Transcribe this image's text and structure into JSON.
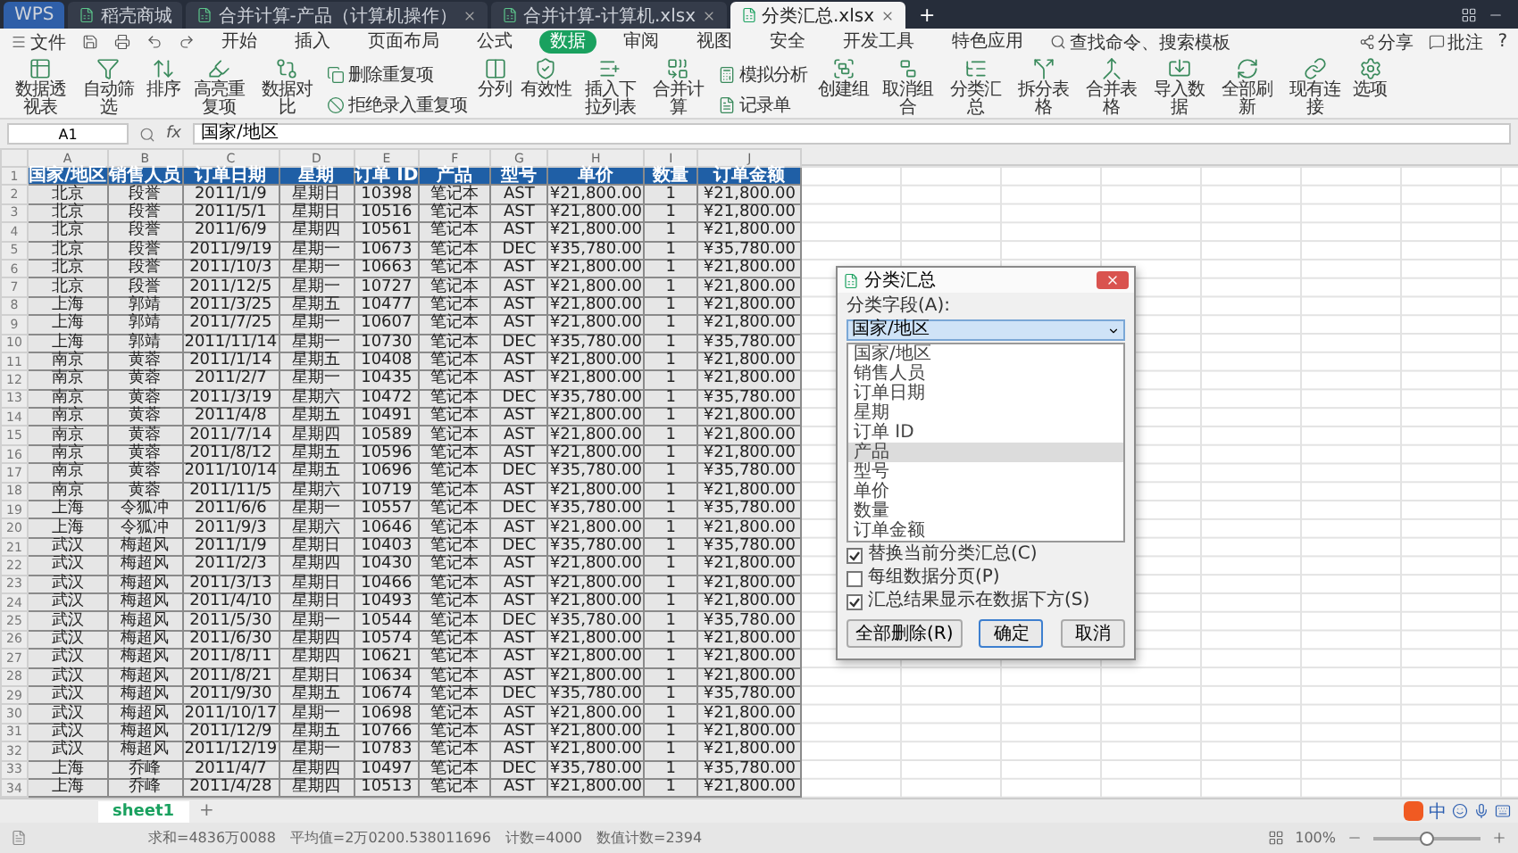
{
  "title_bar": {
    "tabs": [
      {
        "label": "WPS",
        "kind": "app",
        "selected": false
      },
      {
        "label": "稻壳商城",
        "kind": "doc",
        "selected": false
      },
      {
        "label": "合并计算-产品（计算机操作）",
        "kind": "doc",
        "selected": false
      },
      {
        "label": "合并计算-计算机.xlsx",
        "kind": "doc",
        "selected": false
      },
      {
        "label": "分类汇总.xlsx",
        "kind": "doc",
        "selected": true
      }
    ],
    "new_tab": "+"
  },
  "menu": {
    "file": "文件",
    "tabs": [
      {
        "label": "开始",
        "selected": false
      },
      {
        "label": "插入",
        "selected": false
      },
      {
        "label": "页面布局",
        "selected": false
      },
      {
        "label": "公式",
        "selected": false
      },
      {
        "label": "数据",
        "selected": true
      },
      {
        "label": "审阅",
        "selected": false
      },
      {
        "label": "视图",
        "selected": false
      },
      {
        "label": "安全",
        "selected": false
      },
      {
        "label": "开发工具",
        "selected": false
      },
      {
        "label": "特色应用",
        "selected": false
      }
    ],
    "search": "查找命令、搜索模板",
    "share": "分享",
    "comment": "批注",
    "help": "?"
  },
  "ribbon": [
    {
      "kind": "large",
      "label": "数据透视表"
    },
    {
      "kind": "large",
      "label": "自动筛选"
    },
    {
      "kind": "large",
      "label": "排序"
    },
    {
      "kind": "large",
      "label": "高亮重复项"
    },
    {
      "kind": "large",
      "label": "数据对比"
    },
    {
      "kind": "stack",
      "items": [
        "删除重复项",
        "拒绝录入重复项"
      ]
    },
    {
      "kind": "large",
      "label": "分列"
    },
    {
      "kind": "large",
      "label": "有效性"
    },
    {
      "kind": "large",
      "label": "插入下拉列表"
    },
    {
      "kind": "large",
      "label": "合并计算"
    },
    {
      "kind": "stack",
      "items": [
        "模拟分析",
        "记录单"
      ]
    },
    {
      "kind": "large",
      "label": "创建组"
    },
    {
      "kind": "large",
      "label": "取消组合"
    },
    {
      "kind": "large",
      "label": "分类汇总"
    },
    {
      "kind": "large",
      "label": "拆分表格"
    },
    {
      "kind": "large",
      "label": "合并表格"
    },
    {
      "kind": "large",
      "label": "导入数据"
    },
    {
      "kind": "large",
      "label": "全部刷新"
    },
    {
      "kind": "large",
      "label": "现有连接"
    },
    {
      "kind": "large",
      "label": "选项"
    }
  ],
  "formula_bar": {
    "name_box": "A1",
    "fx": "fx",
    "value": "国家/地区"
  },
  "sheet": {
    "columns": [
      "A",
      "B",
      "C",
      "D",
      "E",
      "F",
      "G",
      "H",
      "I",
      "J"
    ],
    "header": {
      "number": "1",
      "cells": [
        "国家/地区",
        "销售人员",
        "订单日期",
        "星期",
        "订单 ID",
        "产品",
        "型号",
        "单价",
        "数量",
        "订单金额"
      ]
    },
    "rows": [
      {
        "number": "2",
        "cells": [
          "北京",
          "段誉",
          "2011/1/9",
          "星期日",
          "10398",
          "笔记本",
          "AST",
          "¥21,800.00",
          "1",
          "¥21,800.00"
        ]
      },
      {
        "number": "3",
        "cells": [
          "北京",
          "段誉",
          "2011/5/1",
          "星期日",
          "10516",
          "笔记本",
          "AST",
          "¥21,800.00",
          "1",
          "¥21,800.00"
        ]
      },
      {
        "number": "4",
        "cells": [
          "北京",
          "段誉",
          "2011/6/9",
          "星期四",
          "10561",
          "笔记本",
          "AST",
          "¥21,800.00",
          "1",
          "¥21,800.00"
        ]
      },
      {
        "number": "5",
        "cells": [
          "北京",
          "段誉",
          "2011/9/19",
          "星期一",
          "10673",
          "笔记本",
          "DEC",
          "¥35,780.00",
          "1",
          "¥35,780.00"
        ]
      },
      {
        "number": "6",
        "cells": [
          "北京",
          "段誉",
          "2011/10/3",
          "星期一",
          "10663",
          "笔记本",
          "AST",
          "¥21,800.00",
          "1",
          "¥21,800.00"
        ]
      },
      {
        "number": "7",
        "cells": [
          "北京",
          "段誉",
          "2011/12/5",
          "星期一",
          "10727",
          "笔记本",
          "AST",
          "¥21,800.00",
          "1",
          "¥21,800.00"
        ]
      },
      {
        "number": "8",
        "cells": [
          "上海",
          "郭靖",
          "2011/3/25",
          "星期五",
          "10477",
          "笔记本",
          "AST",
          "¥21,800.00",
          "1",
          "¥21,800.00"
        ]
      },
      {
        "number": "9",
        "cells": [
          "上海",
          "郭靖",
          "2011/7/25",
          "星期一",
          "10607",
          "笔记本",
          "AST",
          "¥21,800.00",
          "1",
          "¥21,800.00"
        ]
      },
      {
        "number": "10",
        "cells": [
          "上海",
          "郭靖",
          "2011/11/14",
          "星期一",
          "10730",
          "笔记本",
          "DEC",
          "¥35,780.00",
          "1",
          "¥35,780.00"
        ]
      },
      {
        "number": "11",
        "cells": [
          "南京",
          "黄蓉",
          "2011/1/14",
          "星期五",
          "10408",
          "笔记本",
          "AST",
          "¥21,800.00",
          "1",
          "¥21,800.00"
        ]
      },
      {
        "number": "12",
        "cells": [
          "南京",
          "黄蓉",
          "2011/2/7",
          "星期一",
          "10435",
          "笔记本",
          "AST",
          "¥21,800.00",
          "1",
          "¥21,800.00"
        ]
      },
      {
        "number": "13",
        "cells": [
          "南京",
          "黄蓉",
          "2011/3/19",
          "星期六",
          "10472",
          "笔记本",
          "DEC",
          "¥35,780.00",
          "1",
          "¥35,780.00"
        ]
      },
      {
        "number": "14",
        "cells": [
          "南京",
          "黄蓉",
          "2011/4/8",
          "星期五",
          "10491",
          "笔记本",
          "AST",
          "¥21,800.00",
          "1",
          "¥21,800.00"
        ]
      },
      {
        "number": "15",
        "cells": [
          "南京",
          "黄蓉",
          "2011/7/14",
          "星期四",
          "10589",
          "笔记本",
          "AST",
          "¥21,800.00",
          "1",
          "¥21,800.00"
        ]
      },
      {
        "number": "16",
        "cells": [
          "南京",
          "黄蓉",
          "2011/8/12",
          "星期五",
          "10596",
          "笔记本",
          "AST",
          "¥21,800.00",
          "1",
          "¥21,800.00"
        ]
      },
      {
        "number": "17",
        "cells": [
          "南京",
          "黄蓉",
          "2011/10/14",
          "星期五",
          "10696",
          "笔记本",
          "DEC",
          "¥35,780.00",
          "1",
          "¥35,780.00"
        ]
      },
      {
        "number": "18",
        "cells": [
          "南京",
          "黄蓉",
          "2011/11/5",
          "星期六",
          "10719",
          "笔记本",
          "AST",
          "¥21,800.00",
          "1",
          "¥21,800.00"
        ]
      },
      {
        "number": "19",
        "cells": [
          "上海",
          "令狐冲",
          "2011/6/6",
          "星期一",
          "10557",
          "笔记本",
          "DEC",
          "¥35,780.00",
          "1",
          "¥35,780.00"
        ]
      },
      {
        "number": "20",
        "cells": [
          "上海",
          "令狐冲",
          "2011/9/3",
          "星期六",
          "10646",
          "笔记本",
          "AST",
          "¥21,800.00",
          "1",
          "¥21,800.00"
        ]
      },
      {
        "number": "21",
        "cells": [
          "武汉",
          "梅超风",
          "2011/1/9",
          "星期日",
          "10403",
          "笔记本",
          "DEC",
          "¥35,780.00",
          "1",
          "¥35,780.00"
        ]
      },
      {
        "number": "22",
        "cells": [
          "武汉",
          "梅超风",
          "2011/2/3",
          "星期四",
          "10430",
          "笔记本",
          "AST",
          "¥21,800.00",
          "1",
          "¥21,800.00"
        ]
      },
      {
        "number": "23",
        "cells": [
          "武汉",
          "梅超风",
          "2011/3/13",
          "星期日",
          "10466",
          "笔记本",
          "AST",
          "¥21,800.00",
          "1",
          "¥21,800.00"
        ]
      },
      {
        "number": "24",
        "cells": [
          "武汉",
          "梅超风",
          "2011/4/10",
          "星期日",
          "10493",
          "笔记本",
          "AST",
          "¥21,800.00",
          "1",
          "¥21,800.00"
        ]
      },
      {
        "number": "25",
        "cells": [
          "武汉",
          "梅超风",
          "2011/5/30",
          "星期一",
          "10544",
          "笔记本",
          "DEC",
          "¥35,780.00",
          "1",
          "¥35,780.00"
        ]
      },
      {
        "number": "26",
        "cells": [
          "武汉",
          "梅超风",
          "2011/6/30",
          "星期四",
          "10574",
          "笔记本",
          "AST",
          "¥21,800.00",
          "1",
          "¥21,800.00"
        ]
      },
      {
        "number": "27",
        "cells": [
          "武汉",
          "梅超风",
          "2011/8/11",
          "星期四",
          "10621",
          "笔记本",
          "AST",
          "¥21,800.00",
          "1",
          "¥21,800.00"
        ]
      },
      {
        "number": "28",
        "cells": [
          "武汉",
          "梅超风",
          "2011/8/21",
          "星期日",
          "10634",
          "笔记本",
          "AST",
          "¥21,800.00",
          "1",
          "¥21,800.00"
        ]
      },
      {
        "number": "29",
        "cells": [
          "武汉",
          "梅超风",
          "2011/9/30",
          "星期五",
          "10674",
          "笔记本",
          "DEC",
          "¥35,780.00",
          "1",
          "¥35,780.00"
        ]
      },
      {
        "number": "30",
        "cells": [
          "武汉",
          "梅超风",
          "2011/10/17",
          "星期一",
          "10698",
          "笔记本",
          "AST",
          "¥21,800.00",
          "1",
          "¥21,800.00"
        ]
      },
      {
        "number": "31",
        "cells": [
          "武汉",
          "梅超风",
          "2011/12/9",
          "星期五",
          "10766",
          "笔记本",
          "AST",
          "¥21,800.00",
          "1",
          "¥21,800.00"
        ]
      },
      {
        "number": "32",
        "cells": [
          "武汉",
          "梅超风",
          "2011/12/19",
          "星期一",
          "10783",
          "笔记本",
          "AST",
          "¥21,800.00",
          "1",
          "¥21,800.00"
        ]
      },
      {
        "number": "33",
        "cells": [
          "上海",
          "乔峰",
          "2011/4/7",
          "星期四",
          "10497",
          "笔记本",
          "DEC",
          "¥35,780.00",
          "1",
          "¥35,780.00"
        ]
      },
      {
        "number": "34",
        "cells": [
          "上海",
          "乔峰",
          "2011/4/28",
          "星期四",
          "10513",
          "笔记本",
          "AST",
          "¥21,800.00",
          "1",
          "¥21,800.00"
        ]
      }
    ]
  },
  "dialog": {
    "title": "分类汇总",
    "field_label": "分类字段(A):",
    "field_value": "国家/地区",
    "options": [
      {
        "label": "国家/地区",
        "selected": false
      },
      {
        "label": "销售人员",
        "selected": false
      },
      {
        "label": "订单日期",
        "selected": false
      },
      {
        "label": "星期",
        "selected": false
      },
      {
        "label": "订单 ID",
        "selected": false
      },
      {
        "label": "产品",
        "selected": true
      },
      {
        "label": "型号",
        "selected": false
      },
      {
        "label": "单价",
        "selected": false
      },
      {
        "label": "数量",
        "selected": false
      },
      {
        "label": "订单金额",
        "selected": false
      }
    ],
    "checkboxes": [
      {
        "label": "替换当前分类汇总(C)",
        "checked": true
      },
      {
        "label": "每组数据分页(P)",
        "checked": false
      },
      {
        "label": "汇总结果显示在数据下方(S)",
        "checked": true
      }
    ],
    "buttons": [
      {
        "label": "全部删除(R)",
        "kind": "normal"
      },
      {
        "label": "确定",
        "kind": "primary"
      },
      {
        "label": "取消",
        "kind": "normal"
      }
    ]
  },
  "sheet_tabs": [
    {
      "label": "sheet1",
      "selected": true
    }
  ],
  "add_sheet": "+",
  "ime": {
    "mode": "中"
  },
  "status_bar": {
    "stats": [
      "求和=4836万0088",
      "平均值=2万0200.538011696",
      "计数=4000",
      "数值计数=2394"
    ],
    "zoom": "100%",
    "zoom_slider": {
      "level": 0.5
    }
  }
}
